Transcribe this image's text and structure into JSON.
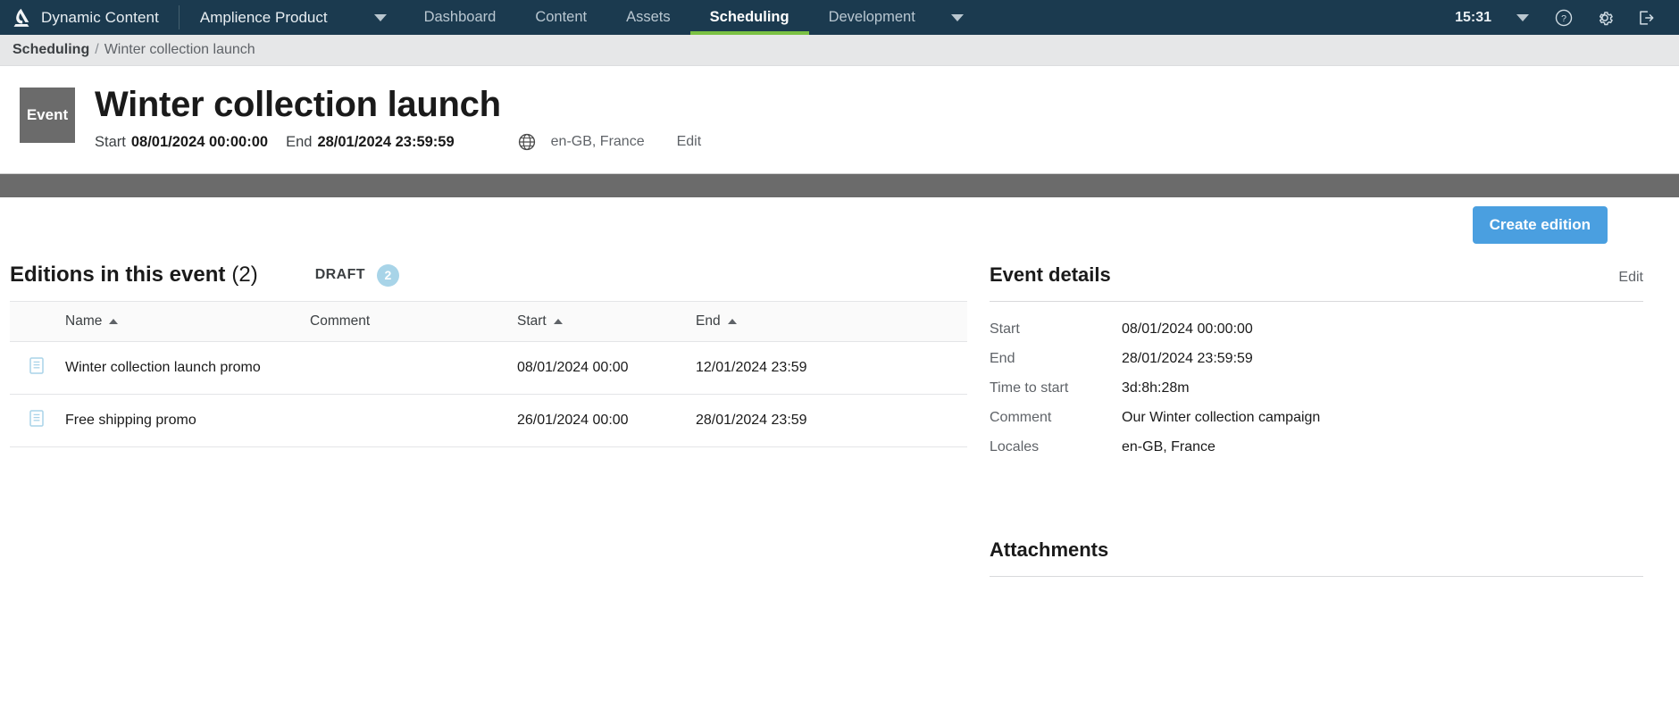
{
  "topnav": {
    "logo_icon": "amplience-logo-icon",
    "brand": "Dynamic Content",
    "product": "Amplience Product",
    "product_caret_icon": "chevron-down-icon",
    "items": [
      {
        "label": "Dashboard",
        "active": false
      },
      {
        "label": "Content",
        "active": false
      },
      {
        "label": "Assets",
        "active": false
      },
      {
        "label": "Scheduling",
        "active": true
      },
      {
        "label": "Development",
        "active": false
      }
    ],
    "development_caret_icon": "chevron-down-icon",
    "clock": "15:31",
    "user_caret_icon": "chevron-down-icon",
    "help_icon": "help-circle-icon",
    "settings_icon": "gear-icon",
    "logout_icon": "logout-icon",
    "active_underline_color": "#7ac143",
    "background_color": "#1b3a4f"
  },
  "breadcrumb": {
    "root": "Scheduling",
    "separator": "/",
    "current": "Winter collection launch"
  },
  "header": {
    "badge": "Event",
    "title": "Winter collection launch",
    "start_label": "Start",
    "start_value": "08/01/2024 00:00:00",
    "end_label": "End",
    "end_value": "28/01/2024 23:59:59",
    "globe_icon": "globe-icon",
    "locales": "en-GB, France",
    "edit": "Edit"
  },
  "toolbar": {
    "create_edition": "Create edition",
    "primary_color": "#4a9fe0"
  },
  "editions": {
    "title": "Editions in this event",
    "count": "(2)",
    "draft_label": "DRAFT",
    "draft_count": "2",
    "draft_badge_color": "#a8d4e8",
    "columns": [
      {
        "label": "Name",
        "sort_icon": "sort-asc-icon"
      },
      {
        "label": "Comment",
        "sort_icon": ""
      },
      {
        "label": "Start",
        "sort_icon": "sort-asc-icon"
      },
      {
        "label": "End",
        "sort_icon": "sort-asc-icon"
      }
    ],
    "rows": [
      {
        "icon": "document-icon",
        "name": "Winter collection launch promo",
        "comment": "",
        "start": "08/01/2024 00:00",
        "end": "12/01/2024 23:59",
        "end_muted": false
      },
      {
        "icon": "document-icon",
        "name": "Free shipping promo",
        "comment": "",
        "start": "26/01/2024 00:00",
        "end": "28/01/2024 23:59",
        "end_muted": true
      }
    ]
  },
  "event_details": {
    "title": "Event details",
    "edit": "Edit",
    "rows": [
      {
        "key": "Start",
        "value": "08/01/2024 00:00:00"
      },
      {
        "key": "End",
        "value": "28/01/2024 23:59:59"
      },
      {
        "key": "Time to start",
        "value": "3d:8h:28m"
      },
      {
        "key": "Comment",
        "value": "Our Winter collection campaign"
      },
      {
        "key": "Locales",
        "value": "en-GB, France"
      }
    ]
  },
  "attachments": {
    "title": "Attachments"
  }
}
